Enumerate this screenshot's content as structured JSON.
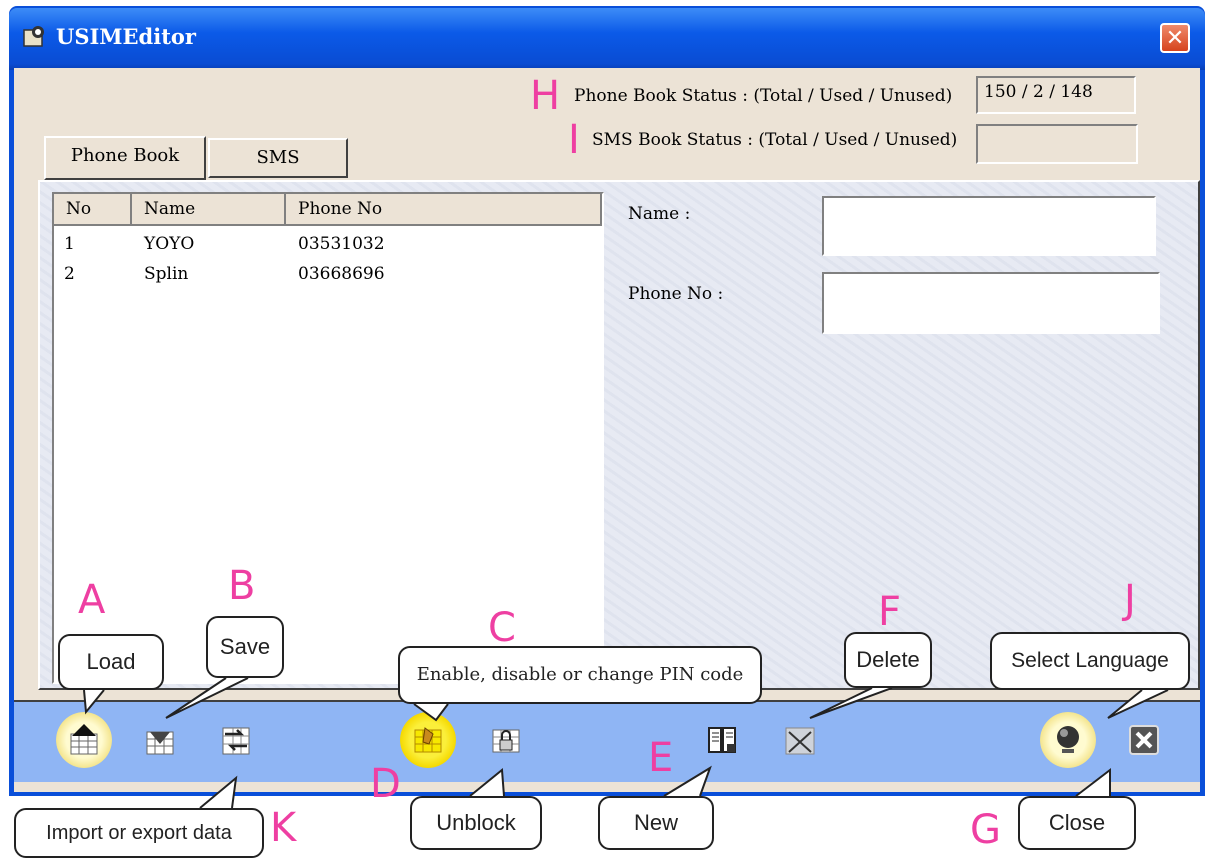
{
  "window": {
    "title": "USIMEditor",
    "close_glyph": "✕"
  },
  "status": {
    "phone_label": "Phone Book Status : (Total / Used / Unused)",
    "phone_value": "150 / 2 / 148",
    "sms_label": "SMS Book Status : (Total / Used / Unused)",
    "sms_value": ""
  },
  "tabs": [
    {
      "label": "Phone Book"
    },
    {
      "label": "SMS"
    }
  ],
  "list": {
    "columns": [
      "No",
      "Name",
      "Phone No"
    ],
    "rows": [
      {
        "no": "1",
        "name": "YOYO",
        "phone": "03531032"
      },
      {
        "no": "2",
        "name": "Splin",
        "phone": "03668696"
      }
    ]
  },
  "form": {
    "name_label": "Name :",
    "name_value": "",
    "phone_label": "Phone No :",
    "phone_value": ""
  },
  "toolbar": {
    "icons": [
      "load-icon",
      "save-icon",
      "import-export-icon",
      "pin-code-icon",
      "unblock-icon",
      "new-icon",
      "delete-icon",
      "language-globe-icon",
      "close-icon"
    ]
  },
  "annotations": {
    "letters": {
      "A": "A",
      "B": "B",
      "C": "C",
      "D": "D",
      "E": "E",
      "F": "F",
      "G": "G",
      "H": "H",
      "I": "I",
      "J": "J",
      "K": "K"
    },
    "callouts": {
      "load": "Load",
      "save": "Save",
      "pin": "Enable, disable or change PIN code",
      "delete": "Delete",
      "language": "Select Language",
      "import_export": "Import or export data",
      "unblock": "Unblock",
      "new": "New",
      "close": "Close"
    }
  },
  "colors": {
    "accent_pink": "#ee3fa2",
    "titlebar_blue": "#0b5ae8",
    "toolbar_blue": "#8fb5f4"
  }
}
